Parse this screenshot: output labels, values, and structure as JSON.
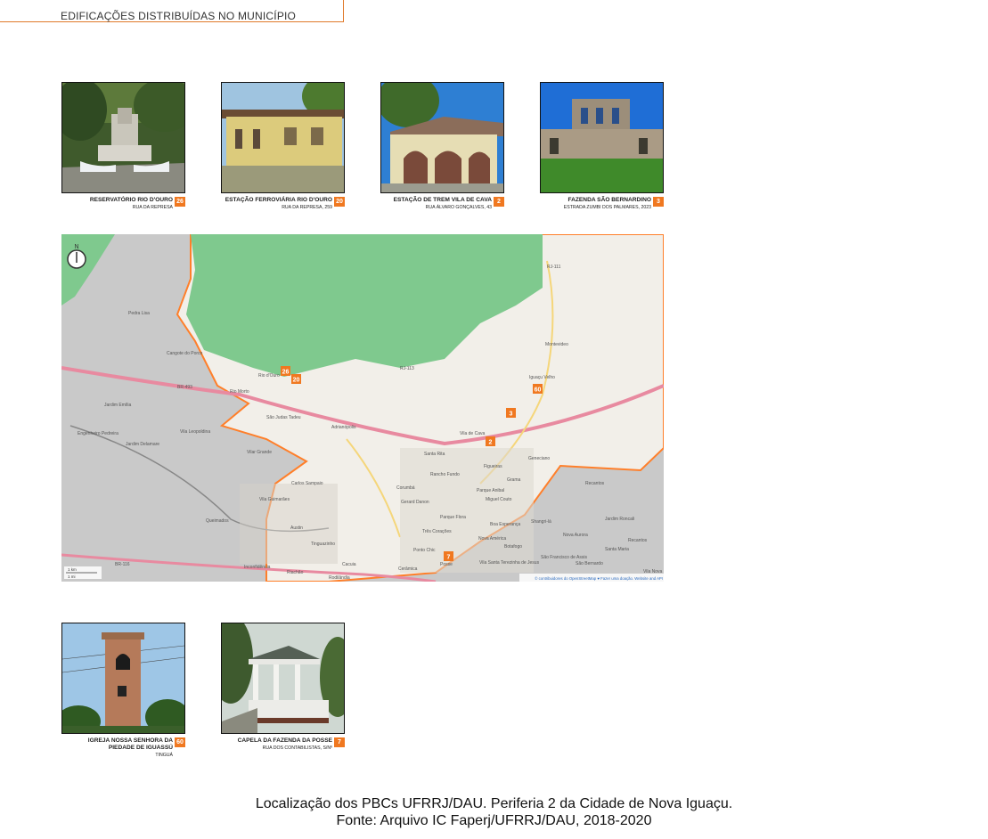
{
  "header": {
    "title": "EDIFICAÇÕES DISTRIBUÍDAS NO MUNICÍPIO"
  },
  "cards_top": [
    {
      "title": "RESERVATÓRIO RIO D'OURO",
      "address": "RUA DA REPRESA",
      "badge": "26"
    },
    {
      "title": "ESTAÇÃO FERROVIÁRIA RIO D'OURO",
      "address": "RUA DA REPRESA, 259",
      "badge": "20"
    },
    {
      "title": "ESTAÇÃO DE TREM VILA DE CAVA",
      "address": "RUA ÁLVARO GONÇALVES, 43",
      "badge": "2"
    },
    {
      "title": "FAZENDA SÃO BERNARDINO",
      "address": "ESTRADA ZUMBI DOS PALMARES, 2023",
      "badge": "3"
    }
  ],
  "cards_bottom": [
    {
      "title": "IGREJA NOSSA SENHORA DA PIEDADE DE IGUASSÚ",
      "address": "TINGUÁ",
      "badge": "60"
    },
    {
      "title": "CAPELA DA FAZENDA DA POSSE",
      "address": "RUA DOS CONTABILISTAS, S/Nº",
      "badge": "7"
    }
  ],
  "map": {
    "north_label": "N",
    "attribution": "© contribuidores do OpenStreetMap ♥ Fazer uma doação. Website and API",
    "scale_km": "1 km",
    "scale_mi": "1 mi",
    "markers": [
      "26",
      "20",
      "60",
      "3",
      "2",
      "7"
    ],
    "places": [
      "Rio d'Ouro",
      "Pedra Lisa",
      "Cangote do Porco",
      "Jardim Emília",
      "Engenheiro Pedreira",
      "Jardim Delamare",
      "Vila Leopoldina",
      "Rio Morto",
      "São Judas Tadeu",
      "Adrianópolis",
      "Vila de Cava",
      "Santa Rita",
      "Figueiras",
      "Geneciano",
      "Montevideo",
      "Iguaçu Velho",
      "Rancho Fundo",
      "Corumbá",
      "Gerard Danon",
      "Parque Anibal",
      "Miguel Couto",
      "Grama",
      "Recantos",
      "Carlos Sampaio",
      "Vila Guimarães",
      "Queimados",
      "Austin",
      "Parque Flora",
      "Três Corações",
      "Boa Esperança",
      "Nova América",
      "Shangri-lá",
      "Nova Aurora",
      "Santa Maria",
      "Tinguazinho",
      "Riachão",
      "Cacuia",
      "Ponto Chic",
      "Posse",
      "Cerâmica",
      "Rodilândia",
      "Vila Santa Terezinha de Jesus",
      "Botafogo",
      "São Francisco de Assis",
      "São Bernardo",
      "Inconfidência",
      "Vila Guimarães",
      "Vilar Grande",
      "Recantos",
      "Jardim Roncali",
      "Vila Nova"
    ],
    "roads": [
      "BR-116",
      "BR-493",
      "RJ-111",
      "RJ-113",
      "Estrada do Tinguá"
    ]
  },
  "caption": {
    "line1": "Localização dos PBCs UFRRJ/DAU. Periferia 2 da Cidade de Nova Iguaçu.",
    "line2": "Fonte: Arquivo IC Faperj/UFRRJ/DAU, 2018-2020"
  },
  "colors": {
    "accent": "#f07820",
    "forest": "#78c88c",
    "urban": "#f2efe9",
    "outside": "#c8c8c8",
    "boundary": "#ff7f2a",
    "highway": "#e88aa0"
  }
}
